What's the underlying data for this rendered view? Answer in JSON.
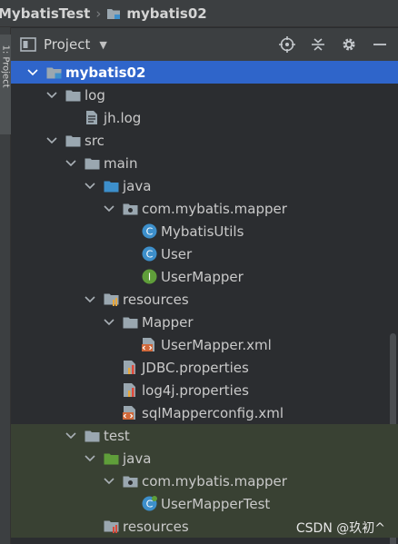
{
  "breadcrumb": {
    "root": "MybatisTest",
    "module": "mybatis02"
  },
  "sidebar": {
    "tab_label": "1: Project"
  },
  "panel": {
    "title": "Project"
  },
  "tree": [
    {
      "label": "mybatis02",
      "icon": "module-folder-icon",
      "expanded": true,
      "selected": true
    },
    {
      "label": "log",
      "icon": "folder-icon",
      "expanded": true
    },
    {
      "label": "jh.log",
      "icon": "text-file-icon"
    },
    {
      "label": "src",
      "icon": "folder-icon",
      "expanded": true
    },
    {
      "label": "main",
      "icon": "folder-icon",
      "expanded": true
    },
    {
      "label": "java",
      "icon": "source-folder-icon",
      "expanded": true
    },
    {
      "label": "com.mybatis.mapper",
      "icon": "package-icon",
      "expanded": true
    },
    {
      "label": "MybatisUtils",
      "icon": "class-icon"
    },
    {
      "label": "User",
      "icon": "class-icon"
    },
    {
      "label": "UserMapper",
      "icon": "interface-icon"
    },
    {
      "label": "resources",
      "icon": "resources-folder-icon",
      "expanded": true
    },
    {
      "label": "Mapper",
      "icon": "folder-icon",
      "expanded": true
    },
    {
      "label": "UserMapper.xml",
      "icon": "xml-file-icon"
    },
    {
      "label": "JDBC.properties",
      "icon": "properties-file-icon"
    },
    {
      "label": "log4j.properties",
      "icon": "properties-file-icon"
    },
    {
      "label": "sqlMapperconfig.xml",
      "icon": "xml-file-icon"
    },
    {
      "label": "test",
      "icon": "folder-icon",
      "expanded": true
    },
    {
      "label": "java",
      "icon": "test-source-folder-icon",
      "expanded": true
    },
    {
      "label": "com.mybatis.mapper",
      "icon": "package-icon",
      "expanded": true
    },
    {
      "label": "UserMapperTest",
      "icon": "test-class-icon"
    },
    {
      "label": "resources",
      "icon": "test-resources-folder-icon"
    }
  ],
  "watermark": "CSDN @玖初^",
  "colors": {
    "selection": "#2f65ca",
    "test_highlight": "#394133",
    "source_folder": "#3d8fcb",
    "test_folder": "#5f9e3a"
  }
}
